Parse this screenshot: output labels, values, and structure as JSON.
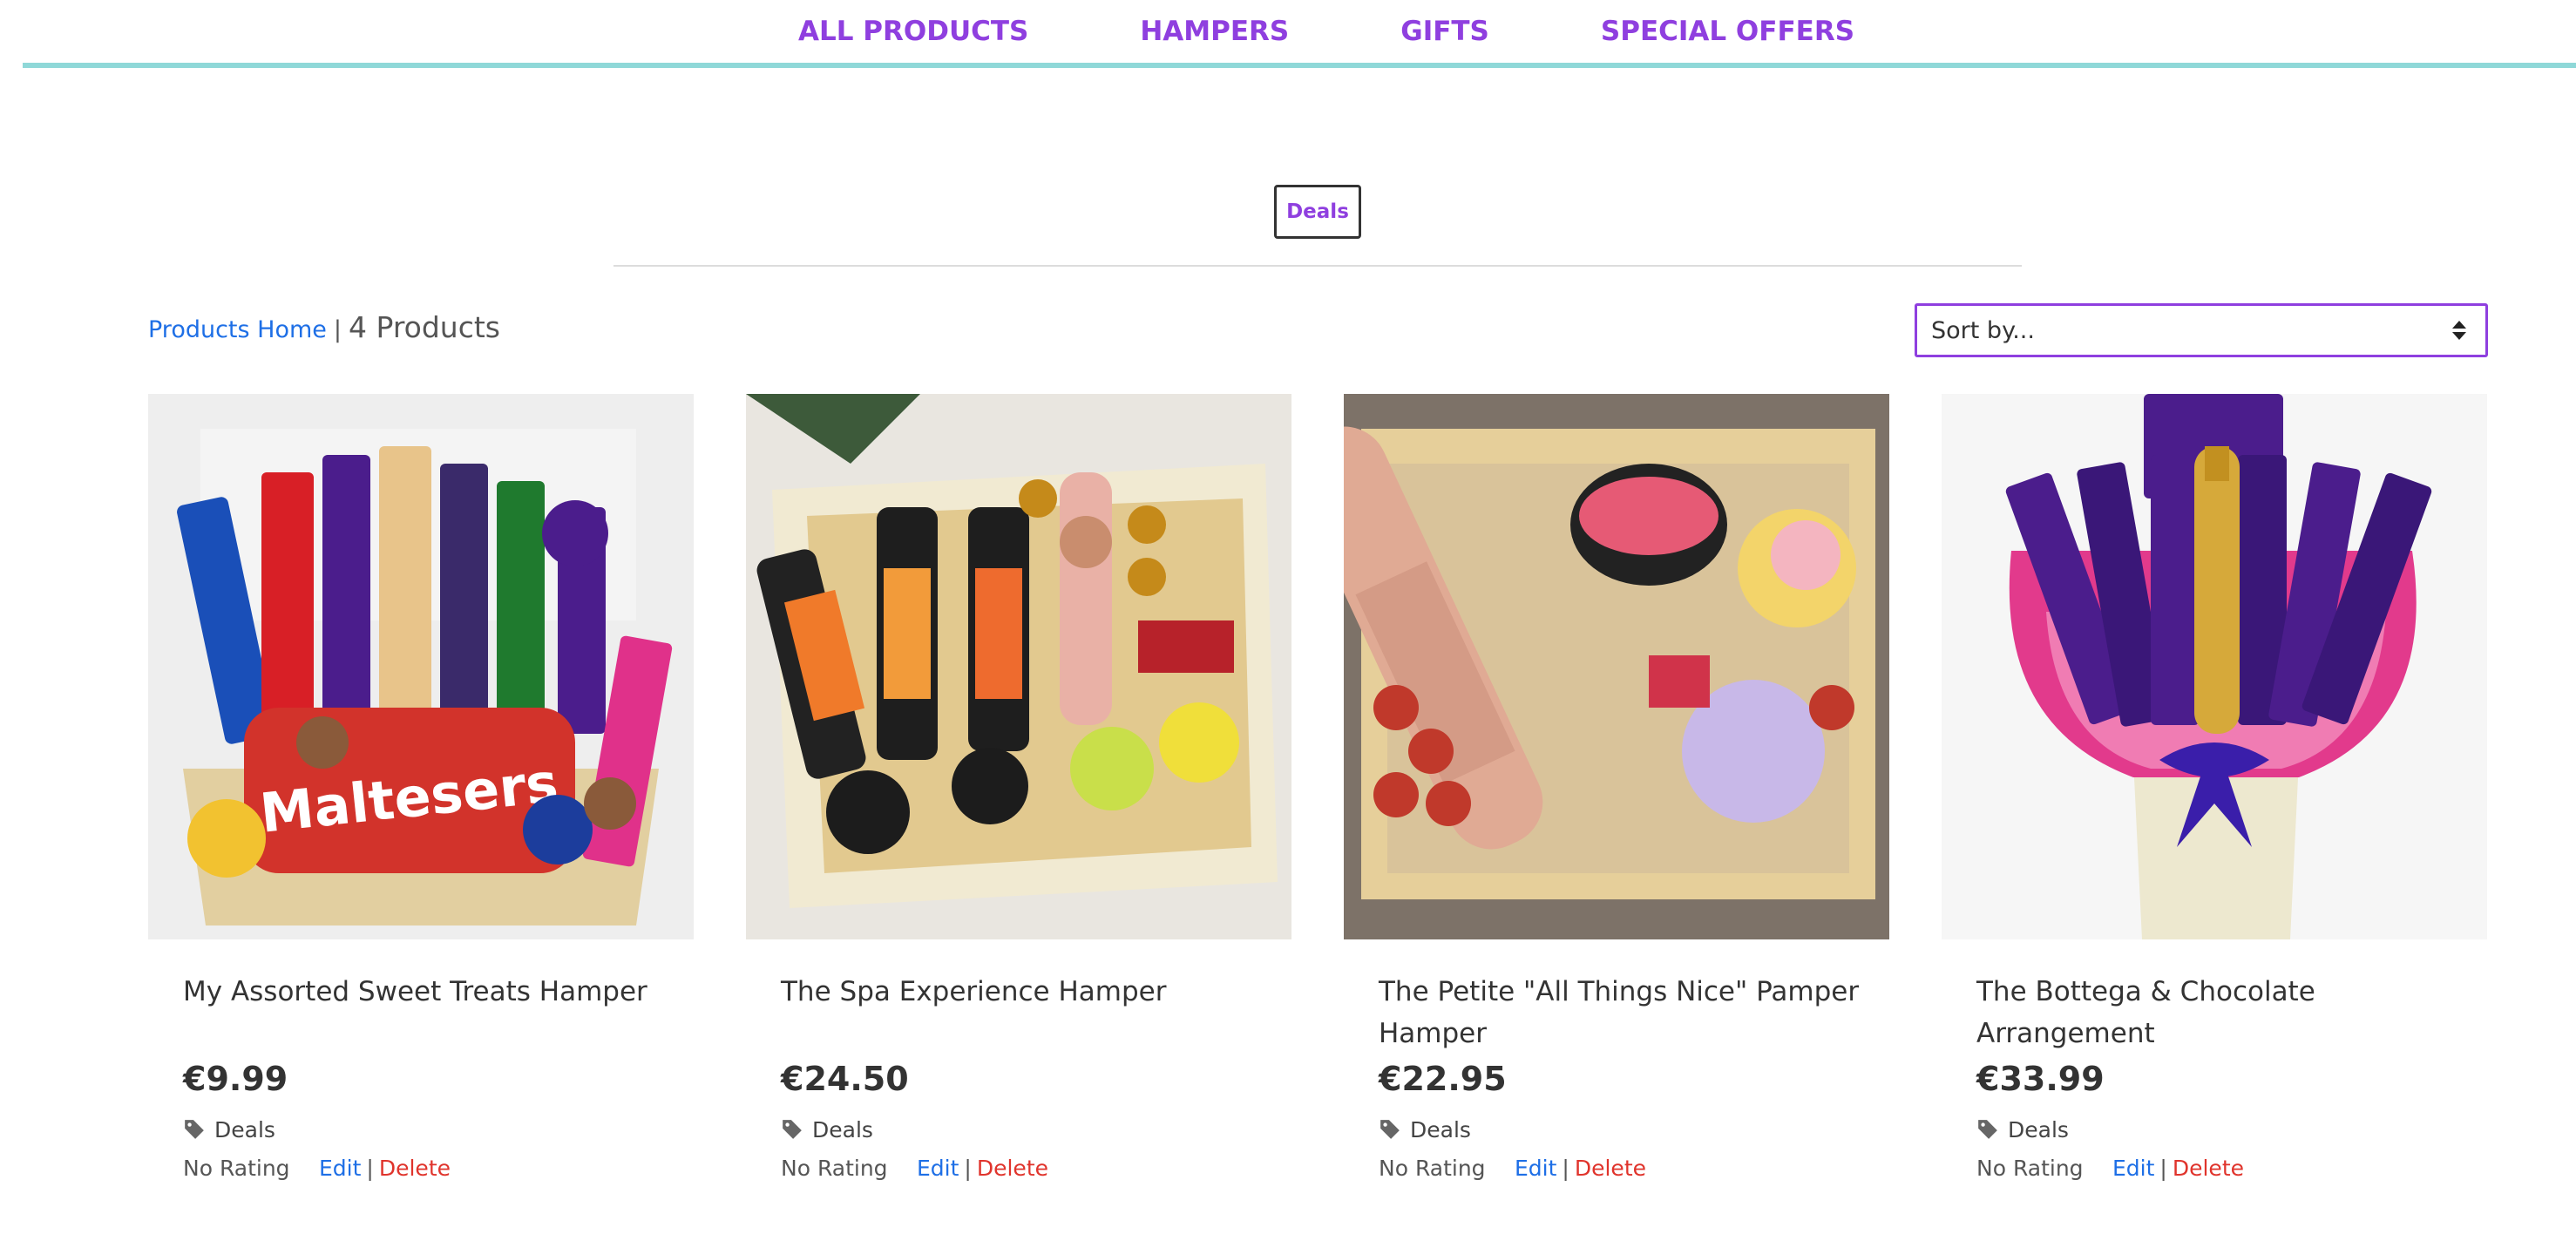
{
  "nav": {
    "items": [
      {
        "label": "ALL PRODUCTS"
      },
      {
        "label": "HAMPERS"
      },
      {
        "label": "GIFTS"
      },
      {
        "label": "SPECIAL OFFERS"
      }
    ]
  },
  "category_badge": "Deals",
  "breadcrumb": {
    "home_label": "Products Home",
    "separator": "|",
    "count_label": "4 Products"
  },
  "sort": {
    "selected": "Sort by..."
  },
  "colors": {
    "accent": "#8f3fdf",
    "nav_border": "#8fd8d8",
    "link": "#1e6fe6",
    "delete": "#e0342c"
  },
  "products": [
    {
      "name": "My Assorted Sweet Treats Hamper",
      "price": "€9.99",
      "category": "Deals",
      "rating": "No Rating",
      "edit_label": "Edit",
      "separator": "|",
      "delete_label": "Delete"
    },
    {
      "name": "The Spa Experience Hamper",
      "price": "€24.50",
      "category": "Deals",
      "rating": "No Rating",
      "edit_label": "Edit",
      "separator": "|",
      "delete_label": "Delete"
    },
    {
      "name": "The Petite \"All Things Nice\" Pamper Hamper",
      "price": "€22.95",
      "category": "Deals",
      "rating": "No Rating",
      "edit_label": "Edit",
      "separator": "|",
      "delete_label": "Delete"
    },
    {
      "name": "The Bottega & Chocolate Arrangement",
      "price": "€33.99",
      "category": "Deals",
      "rating": "No Rating",
      "edit_label": "Edit",
      "separator": "|",
      "delete_label": "Delete"
    }
  ]
}
